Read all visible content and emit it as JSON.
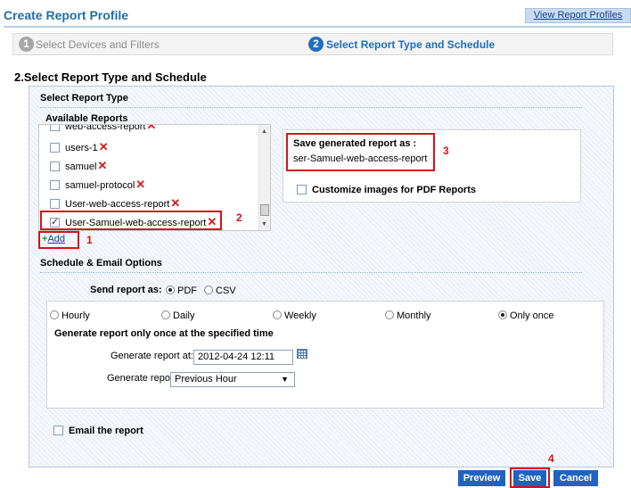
{
  "header": {
    "title": "Create Report Profile",
    "view_profiles_link": "View Report Profiles"
  },
  "wizard": {
    "step1": {
      "number": "1",
      "label": "Select Devices and Filters"
    },
    "step2": {
      "number": "2",
      "label": "Select Report Type and Schedule"
    }
  },
  "section_title": "2.Select Report Type and Schedule",
  "report_type": {
    "heading": "Select Report Type",
    "available_heading": "Available Reports",
    "items": [
      {
        "label": "web-access-report",
        "checked": false
      },
      {
        "label": "users-1",
        "checked": false
      },
      {
        "label": "samuel",
        "checked": false
      },
      {
        "label": "samuel-protocol",
        "checked": false
      },
      {
        "label": "User-web-access-report",
        "checked": false
      },
      {
        "label": "User-Samuel-web-access-report",
        "checked": true
      }
    ],
    "add_label": "Add"
  },
  "save_as": {
    "label": "Save generated report as :",
    "value": "ser-Samuel-web-access-report",
    "customize_label": "Customize images for PDF Reports"
  },
  "annotations": {
    "n1": "1",
    "n2": "2",
    "n3": "3",
    "n4": "4"
  },
  "schedule": {
    "heading": "Schedule & Email Options",
    "send_as_label": "Send report as:",
    "formats": [
      {
        "label": "PDF",
        "selected": true
      },
      {
        "label": "CSV",
        "selected": false
      }
    ],
    "frequencies": [
      {
        "label": "Hourly",
        "selected": false
      },
      {
        "label": "Daily",
        "selected": false
      },
      {
        "label": "Weekly",
        "selected": false
      },
      {
        "label": "Monthly",
        "selected": false
      },
      {
        "label": "Only once",
        "selected": true
      }
    ],
    "once_heading": "Generate report only once at the specified time",
    "generate_at_label": "Generate report at:",
    "generate_at_value": "2012-04-24 12:11",
    "generate_for_label": "Generate report for:",
    "generate_for_value": "Previous Hour",
    "email_label": "Email the report"
  },
  "buttons": {
    "preview": "Preview",
    "save": "Save",
    "cancel": "Cancel"
  },
  "colors": {
    "accent": "#1f6ea8",
    "button": "#1e63c4",
    "highlight": "#d0151b"
  }
}
